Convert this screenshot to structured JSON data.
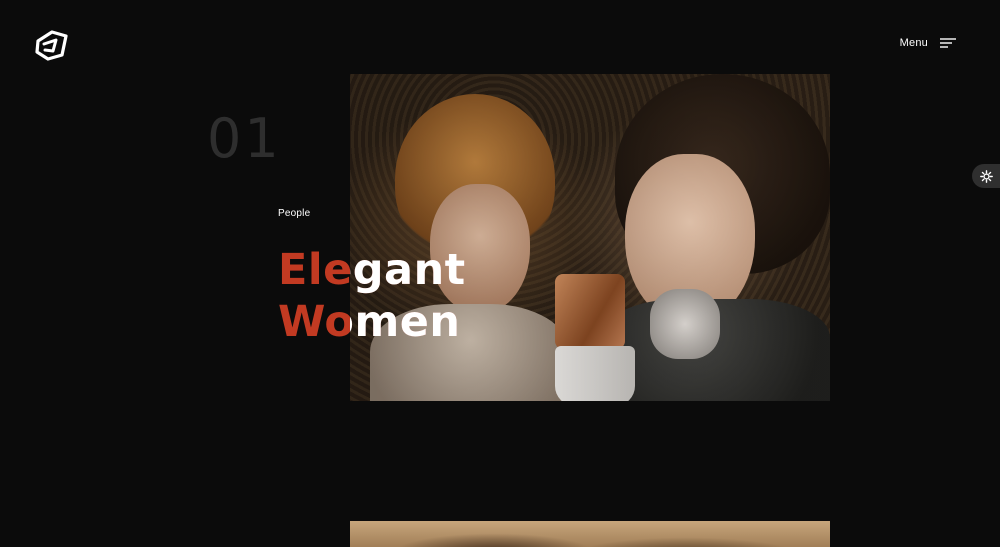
{
  "header": {
    "logo_icon": "brand-logo-icon",
    "menu_label": "Menu",
    "menu_icon": "hamburger-menu-icon"
  },
  "theme_toggle": {
    "icon": "gear-icon"
  },
  "slide": {
    "number": "01",
    "category": "People",
    "title_line_1": "Elegant",
    "title_line_2": "Women",
    "image_alt": "slide-photo"
  },
  "colors": {
    "background": "#0b0b0b",
    "accent": "#c23a22",
    "text": "#ffffff",
    "number": "#2e2e2e"
  }
}
